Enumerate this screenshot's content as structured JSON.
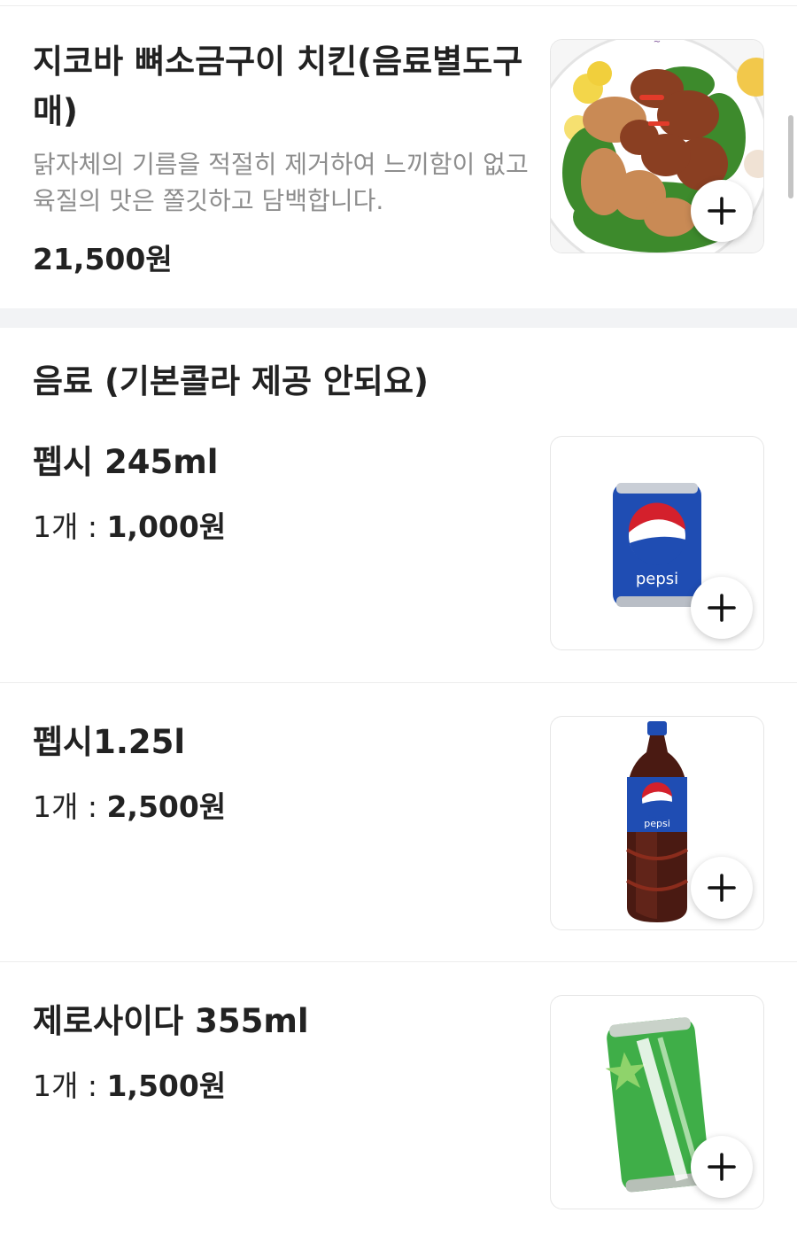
{
  "menu_items": [
    {
      "name": "지코바 뼈소금구이 치킨(음료별도구매)",
      "description": "닭자체의 기름을 적절히 제거하여 느끼함이 없고 육질의 맛은 쫄깃하고 담백합니다.",
      "price": "21,500원",
      "image_icon": "chicken-dish-photo",
      "add_icon": "plus-icon"
    }
  ],
  "section": {
    "title": "음료 (기본콜라 제공 안되요)"
  },
  "drinks": [
    {
      "name": "펩시 245ml",
      "qty_label": "1개 : ",
      "price": "1,000원",
      "image_icon": "pepsi-can-photo",
      "add_icon": "plus-icon"
    },
    {
      "name": "펩시1.25l",
      "qty_label": "1개 : ",
      "price": "2,500원",
      "image_icon": "pepsi-bottle-photo",
      "add_icon": "plus-icon"
    },
    {
      "name": "제로사이다 355ml",
      "qty_label": "1개 : ",
      "price": "1,500원",
      "image_icon": "cider-can-photo",
      "add_icon": "plus-icon"
    }
  ],
  "colors": {
    "pepsi_blue": "#1f4db3",
    "pepsi_red": "#d4202c",
    "cider_green": "#3fae48",
    "description_gray": "#8e8e8e",
    "section_gap": "#f2f3f5"
  }
}
